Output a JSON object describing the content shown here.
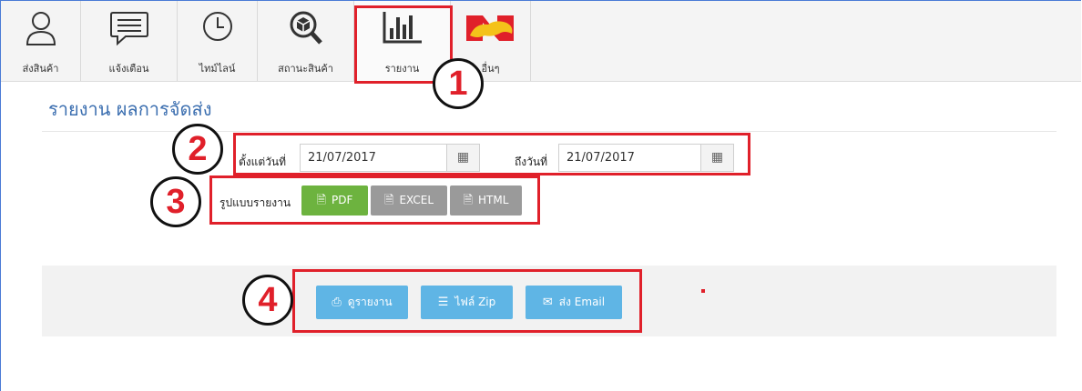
{
  "toolbar": {
    "items": [
      {
        "label": "ส่งสินค้า",
        "icon": "user-icon"
      },
      {
        "label": "แจ้งเตือน",
        "icon": "chat-icon"
      },
      {
        "label": "ไทม์ไลน์",
        "icon": "clock-icon"
      },
      {
        "label": "สถานะสินค้า",
        "icon": "package-search-icon"
      },
      {
        "label": "รายงาน",
        "icon": "bar-chart-icon"
      },
      {
        "label": "อื่นๆ",
        "icon": "brand-logo-icon"
      }
    ]
  },
  "annotations": [
    "1",
    "2",
    "3",
    "4"
  ],
  "page": {
    "title": "รายงาน ผลการจัดส่ง"
  },
  "form": {
    "from_label": "ตั้งแต่วันที่",
    "from_value": "21/07/2017",
    "to_label": "ถึงวันที่",
    "to_value": "21/07/2017",
    "format_label": "รูปแบบรายงาน",
    "formats": [
      {
        "label": "PDF",
        "color": "#6db33f"
      },
      {
        "label": "EXCEL",
        "color": "#9a9a9a"
      },
      {
        "label": "HTML",
        "color": "#9a9a9a"
      }
    ]
  },
  "actions": {
    "view_report": "ดูรายงาน",
    "zip_file": "ไฟล์ Zip",
    "send_email": "ส่ง Email"
  },
  "colors": {
    "accent": "#3c6fb0",
    "action": "#5fb5e5",
    "annotation": "#e0202a"
  }
}
